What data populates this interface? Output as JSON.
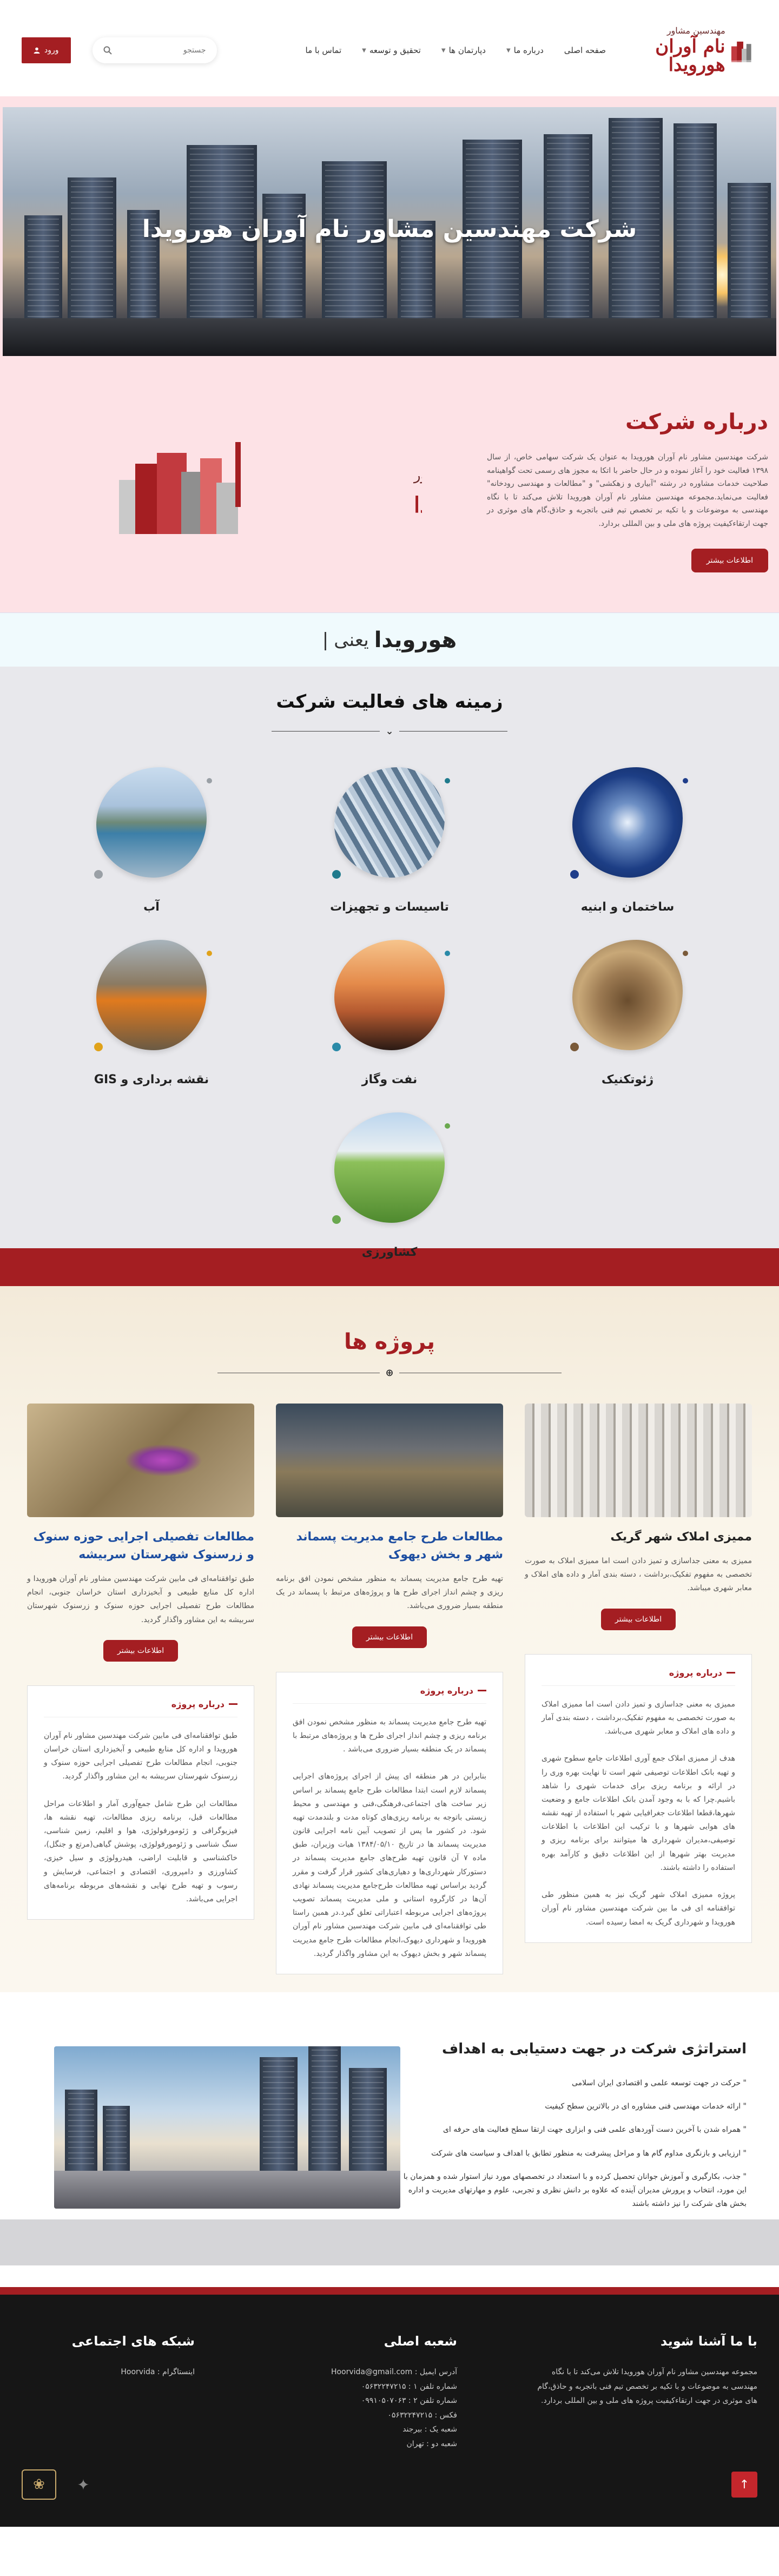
{
  "header": {
    "logo_line1": "مهندسین مشاور",
    "logo_line2": "نام آوران هورویدا",
    "nav": [
      "صفحه اصلی",
      "درباره ما",
      "دپارتمان ها",
      "تحقیق و توسعه",
      "تماس با ما"
    ],
    "nav_has_submenu": [
      false,
      true,
      true,
      true,
      false
    ],
    "search_placeholder": "جستجو",
    "login_label": "ورود"
  },
  "hero": {
    "title": "شرکت مهندسین مشاور نام آوران هورویدا"
  },
  "about": {
    "title": "درباره شرکت",
    "text": "شرکت مهندسین مشاور نام آوران هورویدا به عنوان یک شرکت سهامی خاص، از سال ۱۳۹۸ فعالیت خود را آغاز نموده و در حال حاضر با اتکا به مجوز های رسمی تحت گواهینامه صلاحیت خدمات مشاوره در رشته \"آبیاری و زهکشی\" و \"مطالعات و مهندسی رودخانه\" فعالیت می‌نماید.مجموعه مهندسین مشاور نام آوران هورویدا تلاش می‌کند تا با نگاه مهندسی به موضوعات و با تکیه بر تخصص تیم فنی باتجربه و حاذق،گام های موثری در جهت ارتقاءکیفیت پروژه های ملی و بین المللی بردارد.",
    "button": "اطلاعات بیشتر"
  },
  "tagline": {
    "brand": "هورویدا",
    "word": "یعنی"
  },
  "activities": {
    "title": "زمینه های فعالیت شرکت",
    "items": [
      {
        "label": "ساختمان و ابنیه",
        "icon": "building-icon",
        "dot": "#1f3d8a"
      },
      {
        "label": "تاسیسات و تجهیزات",
        "icon": "pipes-icon",
        "dot": "#1f7a8c"
      },
      {
        "label": "آب",
        "icon": "dam-icon",
        "dot": "#9aa0a6"
      },
      {
        "label": "ژئوتکنیک",
        "icon": "excavation-icon",
        "dot": "#7a5a3a"
      },
      {
        "label": "نفت وگاز",
        "icon": "oil-pump-icon",
        "dot": "#2a8aa8"
      },
      {
        "label": "نقشه برداری و GIS",
        "icon": "surveyor-icon",
        "dot": "#e0a21a"
      },
      {
        "label": "کشاورزی",
        "icon": "irrigation-icon",
        "dot": "#6aa84f"
      }
    ]
  },
  "projects": {
    "title": "پروژه ها",
    "details_label": "درباره پروژه",
    "button": "اطلاعات بیشتر",
    "items": [
      {
        "title": "ممیزی املاک شهر گریک",
        "summary": "ممیزی به معنی جداسازی و تمیز دادن است اما ممیزی املاک به صورت تخصصی به مفهوم تفکیک،برداشت ، دسته بندی آمار و داده های املاک و معابر شهری میباشد.",
        "details": "ممیزی به معنی جداسازی و تمیز دادن است اما ممیزی املاک به صورت تخصصی به مفهوم تفکیک،برداشت ، دسته بندی آمار و داده های املاک و معابر شهری می‌باشد.\n\nهدف از ممیزی املاک جمع آوری اطلاعات جامع سطوح شهری و تهیه بانک اطلاعات توصیفی شهر است تا نهایت بهره وری را در ارائه و برنامه ریزی برای خدمات شهری را شاهد باشیم.چرا که با به وجود آمدن بانک اطلاعات جامع و وضعیت شهرها،قطعا اطلاعات جغرافیایی شهر با استفاده از تهیه نقشه های هوایی شهرها و با ترکیب این اطلاعات با اطلاعات توصیفی،مدیران شهرداری ها میتوانند برای برنامه ریزی و مدیریت بهتر شهرها از این اطلاعات دقیق و کارآمد بهره استفاده را داشته باشند.\n\nپروژه ممیزی املاک شهر گریک نیز به همین منظور طی توافقنامه ای فی ما بین شرکت مهندسین مشاور نام آوران هورویدا و شهرداری گریک به امضا رسیده است."
      },
      {
        "title": "مطالعات طرح جامع مدیریت پسماند شهر و بخش دیهوک",
        "summary": "تهیه طرح جامع مدیریت پسماند به منظور مشخص نمودن افق برنامه ریزی و چشم انداز اجرای طرح ها و پروژه‌های مرتبط با پسماند در یک منطقه بسیار ضروری می‌باشد.",
        "details": "تهیه طرح جامع مدیریت پسماند به منظور مشخص نمودن افق برنامه ریزی و چشم انداز اجرای طرح ها و پروژه‌های مرتبط با پسماند در یک منطقه بسیار ضروری می‌باشد .\n\nبنابراین در هر منطقه ای پیش از اجرای پروژه‌های اجرایی پسماند لازم است ابتدا مطالعات طرح جامع پسماند بر اساس زیر ساخت های اجتماعی،فرهنگی،فنی و مهندسی و محیط زیستی باتوجه به برنامه ریزی‌های کوتاه مدت و بلندمدت تهیه شود. در کشور ما پس از تصویب آیین نامه اجرایی قانون مدیریت پسماند ها در تاریخ ۱۳۸۴/۰۵/۱۰ هیات وزیران، طبق ماده ۷ آن قانون تهیه طرح‌های جامع مدیریت پسماند در دستورکار شهرداری‌ها و دهیاری‌های کشور قرار گرفت و مقرر گردید براساس تهیه مطالعات طرح‌جامع مدیریت پسماند نهادی آن‌ها در کارگروه استانی و ملی مدیریت پسماند تصویب پروژه‌های اجرایی مربوطه اعتباراتی تعلق گیرد.در همین راستا طی توافقنامه‌ای فی مابین شرکت مهندسین مشاور نام آوران هورویدا و شهرداری دیهوک،انجام مطالعات طرح جامع مدیریت پسماند شهر و بخش دیهوک به این مشاور واگذار گردید."
      },
      {
        "title": "مطالعات تفصیلی اجرایی حوزه سنوک و زرسنوک شهرستان سربیشه",
        "summary": "طبق توافقنامه‌ای فی مابین شرکت مهندسین مشاور نام آوران هورویدا و اداره کل منابع طبیعی و آبخیزداری استان خراسان جنوبی، انجام مطالعات طرح تفصیلی اجرایی حوزه سنوک و زرسنوک شهرستان سربیشه به این مشاور واگذار گردید.",
        "details": "طبق توافقنامه‌ای فی مابین شرکت مهندسین مشاور نام آوران هورویدا و اداره کل منابع طبیعی و آبخیزداری استان خراسان جنوبی، انجام مطالعات طرح تفصیلی اجرایی حوزه سنوک و زرسنوک شهرستان سربیشه به این مشاور واگذار گردید.\n\nمطالعات این طرح شامل جمع‌آوری آمار و اطلاعات مراحل مطالعات قبل، برنامه ریزی مطالعات، تهیه نقشه ها، فیزیوگرافی و ژئومورفولوژی، هوا و اقلیم، زمین شناسی، سنگ شناسی و ژئومورفولوژی، پوشش گیاهی(مرتع و جنگل)، خاکشناسی و قابلیت اراضی، هیدرولوژی و سیل خیزی، کشاورزی و دامپروری، اقتصادی و اجتماعی، فرسایش و رسوب و تهیه طرح نهایی و نقشه‌های مربوطه برنامه‌های اجرایی می‌باشد."
      }
    ]
  },
  "strategy": {
    "title": "استراتژی شرکت در جهت دستیابی به اهداف",
    "items": [
      "حرکت در جهت توسعه علمی و اقتصادی ایران اسلامی",
      "ارائه خدمات مهندسی فنی مشاوره ای در بالاترین سطح کیفیت",
      "همراه شدن با آخرین دست آوردهای علمی فنی و ابزاری جهت ارتقا سطح فعالیت های حرفه ای",
      "ارزیابی و بازنگری مداوم گام ها و مراحل پیشرفت به منظور تطابق با اهداف و سیاست های شرکت",
      "جذب، بکارگیری و آموزش جوانان تحصیل کرده و با استعداد در تخصصهای مورد نیاز استوار شده و همزمان با این مورد، انتخاب و پرورش مدیران آینده که علاوه بر دانش نظری و تجربی، علوم و مهارتهای مدیریت و اداره بخش های شرکت را نیز داشته باشند"
    ]
  },
  "footer": {
    "about_title": "با ما آشنا شوید",
    "about_text": "مجموعه مهندسین مشاور نام آوران هورویدا تلاش می‌کند تا با نگاه مهندسی به موضوعات و با تکیه بر تخصص تیم فنی باتجربه و حاذق،گام های موثری در جهت ارتقاءکیفیت پروژه های ملی و بین المللی بردارد.",
    "office_title": "شعبه اصلی",
    "office_lines": [
      "آدرس ایمیل : Hoorvida@gmail.com",
      "شماره تلفن ۱ : ۰۵۶۳۲۲۴۷۲۱۵",
      "شماره تلفن ۲ : ۰۹۹۱۰۵۰۷۰۶۳",
      "فکس : ۰۵۶۳۲۲۴۷۲۱۵",
      "شعبه یک : بیرجند",
      "شعبه دو : تهران"
    ],
    "social_title": "شبکه های اجتماعی",
    "social_text": "اینستاگرام : Hoorvida",
    "to_top": "↑"
  },
  "colors": {
    "brand": "#a41e22",
    "hero_bg": "#fde2e6",
    "footer_bg": "#161616"
  }
}
